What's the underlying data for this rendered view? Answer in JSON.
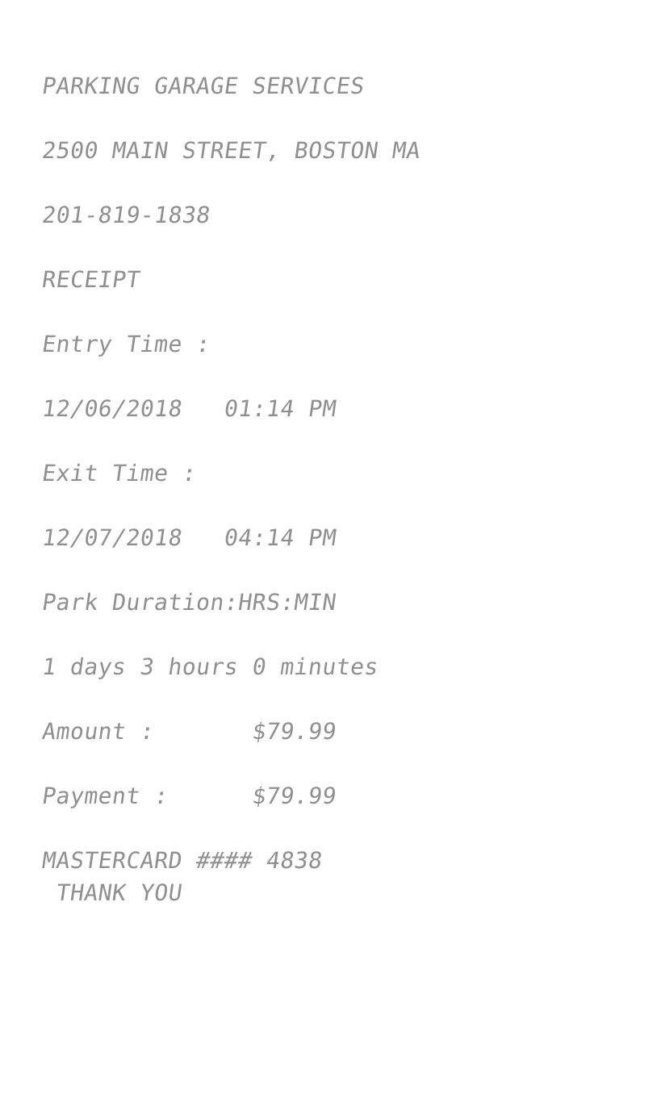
{
  "receipt": {
    "business_name": "PARKING GARAGE SERVICES",
    "address": "2500 MAIN STREET, BOSTON MA",
    "phone": "201-819-1838",
    "doc_title": "RECEIPT",
    "entry_label": "Entry Time :",
    "entry_value": "12/06/2018   01:14 PM",
    "exit_label": "Exit Time :",
    "exit_value": "12/07/2018   04:14 PM",
    "duration_label": "Park Duration:HRS:MIN",
    "duration_value": "1 days 3 hours 0 minutes",
    "amount_line": "Amount :       $79.99",
    "payment_line": "Payment :      $79.99",
    "card_line": "MASTERCARD #### 4838",
    "thanks": " THANK YOU"
  }
}
